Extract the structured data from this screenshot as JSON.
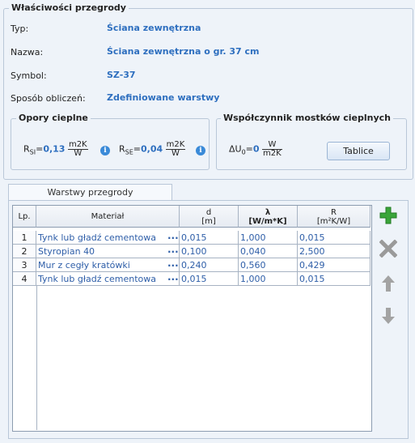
{
  "section_title": "Właściwości przegrody",
  "props": [
    {
      "label": "Typ:",
      "value": "Ściana zewnętrzna"
    },
    {
      "label": "Nazwa:",
      "value": "Ściana zewnętrzna o gr. 37 cm"
    },
    {
      "label": "Symbol:",
      "value": "SZ-37"
    },
    {
      "label": "Sposób obliczeń:",
      "value": "Zdefiniowane warstwy"
    }
  ],
  "resist": {
    "title": "Opory cieplne",
    "rsi_symbol": "R",
    "rsi_sub": "SI",
    "rsi_value": "0,13",
    "rse_symbol": "R",
    "rse_sub": "SE",
    "rse_value": "0,04",
    "unit_num": "m2K",
    "unit_den": "W",
    "info_icon": "i"
  },
  "bridge": {
    "title": "Współczynnik mostków cieplnych",
    "symbol": "ΔU",
    "sub": "0",
    "value": "0",
    "unit_num": "W",
    "unit_den": "m2K",
    "button": "Tablice"
  },
  "tab_label": "Warstwy przegrody",
  "columns": {
    "lp": "Lp.",
    "material": "Materiał",
    "d": "d",
    "d_unit": "[m]",
    "lambda": "λ",
    "lambda_unit": "[W/m*K]",
    "r": "R",
    "r_unit": "[m²K/W]"
  },
  "rows": [
    {
      "lp": "1",
      "material": "Tynk lub gładź cementowa",
      "d": "0,015",
      "lambda": "1,000",
      "r": "0,015"
    },
    {
      "lp": "2",
      "material": "Styropian 40",
      "d": "0,100",
      "lambda": "0,040",
      "r": "2,500"
    },
    {
      "lp": "3",
      "material": "Mur z cegły kratówki",
      "d": "0,240",
      "lambda": "0,560",
      "r": "0,429"
    },
    {
      "lp": "4",
      "material": "Tynk lub gładź cementowa",
      "d": "0,015",
      "lambda": "1,000",
      "r": "0,015"
    }
  ],
  "dots_label": "...",
  "icons": {
    "add": "plus-icon",
    "delete": "x-icon",
    "up": "arrow-up-icon",
    "down": "arrow-down-icon"
  },
  "colors": {
    "accent": "#2e6fbf",
    "add_green": "#3aa53a",
    "gray_icon": "#9a9a9a"
  }
}
